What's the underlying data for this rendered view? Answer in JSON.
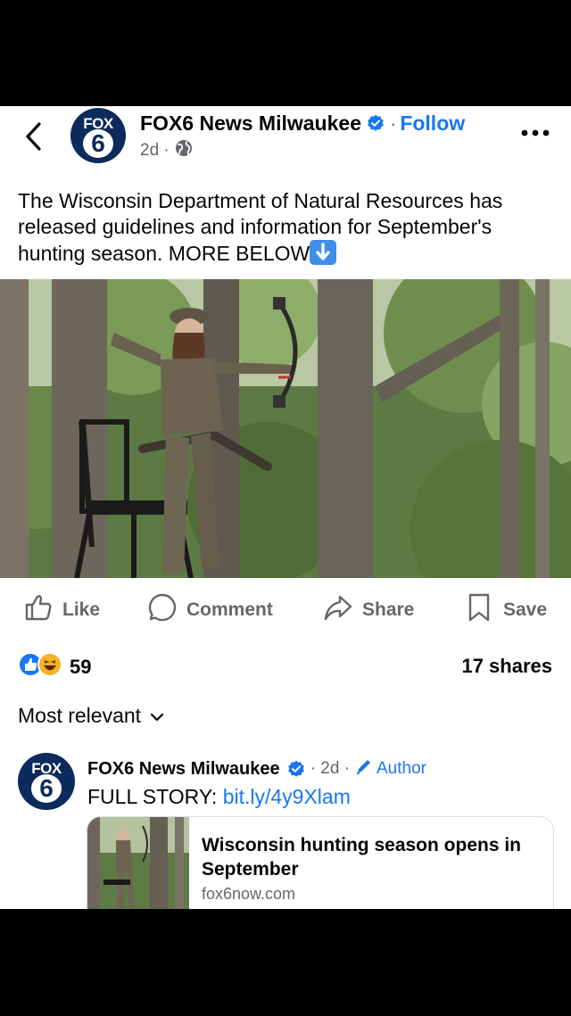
{
  "header": {
    "avatar_top": "FOX",
    "avatar_bottom": "6",
    "page_name": "FOX6 News Milwaukee",
    "separator": "·",
    "follow_label": "Follow",
    "time": "2d ·"
  },
  "post": {
    "text": "The Wisconsin Department of Natural Resources has released guidelines and information for September's hunting season. MORE BELOW"
  },
  "actions": {
    "like": "Like",
    "comment": "Comment",
    "share": "Share",
    "save": "Save"
  },
  "stats": {
    "reaction_count": "59",
    "shares": "17 shares"
  },
  "comments": {
    "sort_label": "Most relevant",
    "items": [
      {
        "avatar_top": "FOX",
        "avatar_bottom": "6",
        "name": "FOX6 News Milwaukee",
        "time": "· 2d ·",
        "author_label": "Author",
        "text_prefix": "FULL STORY: ",
        "link_text": "bit.ly/4y9Xlam",
        "card": {
          "title": "Wisconsin hunting season opens in September",
          "domain": "fox6now.com"
        }
      }
    ]
  },
  "colors": {
    "link_blue": "#1877f2",
    "secondary_text": "#65676b",
    "avatar_navy": "#0d2a5c"
  }
}
